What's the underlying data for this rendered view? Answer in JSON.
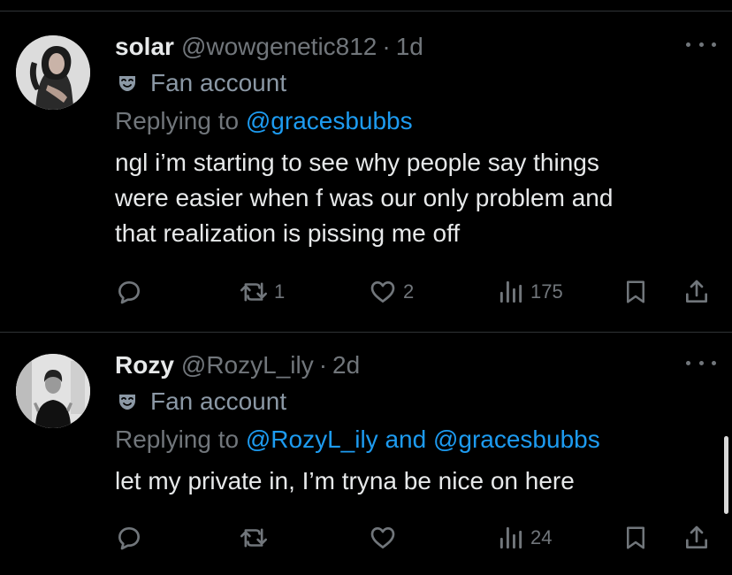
{
  "tweets": [
    {
      "name": "solar",
      "handle": "@wowgenetic812",
      "separator": "·",
      "time": "1d",
      "label": "Fan account",
      "reply_prefix": "Replying to ",
      "reply_mention": "@gracesbubbs",
      "reply_joiner": "",
      "reply_mention_2": "",
      "text": "ngl i’m starting to see why people say things\nwere easier when f was our only problem and\nthat realization is pissing me off",
      "actions": {
        "reply_count": "",
        "retweet_count": "1",
        "like_count": "2",
        "views_count": "175"
      }
    },
    {
      "name": "Rozy",
      "handle": "@RozyL_ily",
      "separator": "·",
      "time": "2d",
      "label": "Fan account",
      "reply_prefix": "Replying to ",
      "reply_mention": "@RozyL_ily",
      "reply_joiner": " and ",
      "reply_mention_2": "@gracesbubbs",
      "text": "let my private in, I’m tryna be nice on here",
      "actions": {
        "reply_count": "",
        "retweet_count": "",
        "like_count": "",
        "views_count": "24"
      }
    }
  ],
  "icons": {
    "label": "mask-icon",
    "more": "more-dots-icon",
    "reply": "reply-bubble-icon",
    "retweet": "retweet-icon",
    "like": "heart-icon",
    "views": "views-bars-icon",
    "bookmark": "bookmark-icon",
    "share": "share-icon"
  },
  "colors": {
    "background": "#000000",
    "text": "#e7e9ea",
    "muted": "#71767b",
    "label": "#8b98a5",
    "mention": "#1d9bf0",
    "divider": "#2f3336"
  }
}
